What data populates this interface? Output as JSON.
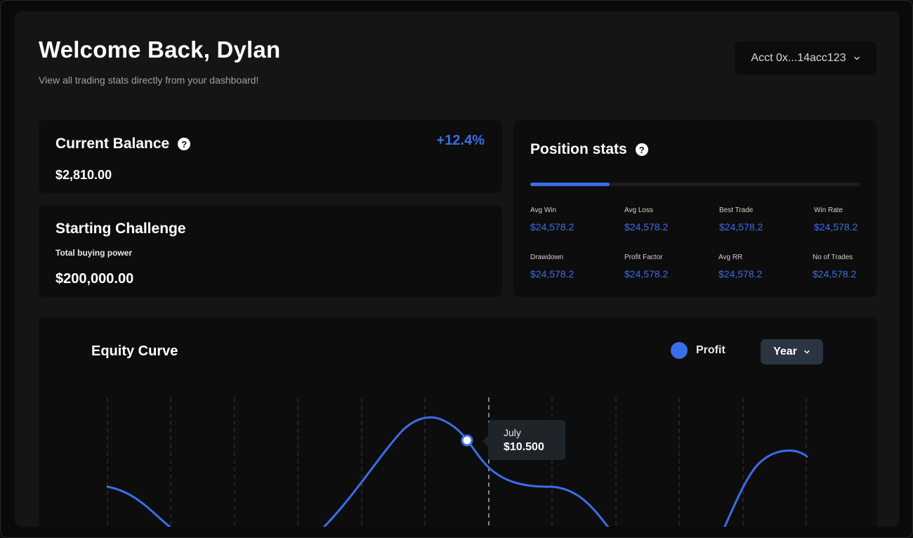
{
  "header": {
    "title": "Welcome Back, Dylan",
    "subtitle": "View all trading stats directly from your dashboard!",
    "account_selector": "Acct 0x...14acc123"
  },
  "balance_card": {
    "title": "Current Balance",
    "change": "+12.4%",
    "value": "$2,810.00"
  },
  "challenge_card": {
    "title": "Starting Challenge",
    "label": "Total buying power",
    "value": "$200,000.00"
  },
  "position_stats": {
    "title": "Position stats",
    "progress_fraction": 0.24,
    "stats": [
      {
        "label": "Avg Win",
        "value": "$24,578.2"
      },
      {
        "label": "Avg Loss",
        "value": "$24,578.2"
      },
      {
        "label": "Best Trade",
        "value": "$24,578.2"
      },
      {
        "label": "Win Rate",
        "value": "$24,578.2"
      },
      {
        "label": "Drawdown",
        "value": "$24,578.2"
      },
      {
        "label": "Profit Factor",
        "value": "$24,578.2"
      },
      {
        "label": "Avg RR",
        "value": "$24,578.2"
      },
      {
        "label": "No of Trades",
        "value": "$24,578.2"
      }
    ]
  },
  "equity_chart": {
    "title": "Equity Curve",
    "legend": "Profit",
    "period": "Year",
    "tooltip": {
      "month": "July",
      "value": "$10.500"
    }
  },
  "colors": {
    "accent": "#3a6ee8",
    "background": "#151515",
    "card": "#0d0d0d"
  }
}
